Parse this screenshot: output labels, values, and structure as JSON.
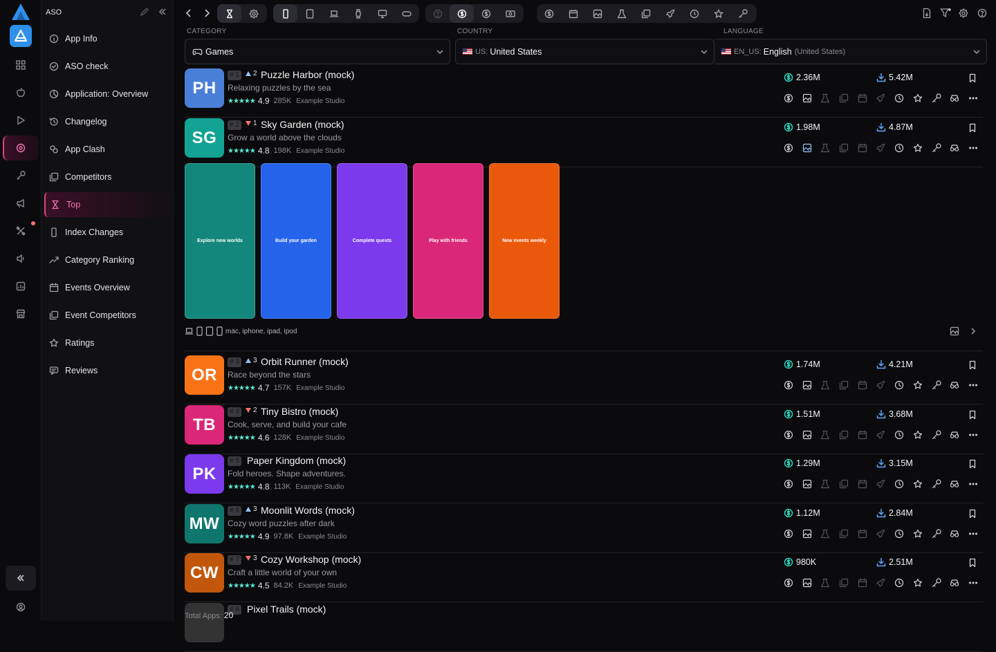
{
  "sidebar": {
    "title": "ASO",
    "items": [
      {
        "label": "App Info",
        "icon": "info-icon"
      },
      {
        "label": "ASO check",
        "icon": "check-circle-icon"
      },
      {
        "label": "Application: Overview",
        "icon": "chart-pie-icon"
      },
      {
        "label": "Changelog",
        "icon": "history-icon"
      },
      {
        "label": "App Clash",
        "icon": "clash-icon"
      },
      {
        "label": "Competitors",
        "icon": "copy-icon"
      },
      {
        "label": "Top",
        "icon": "hourglass-icon",
        "active": true
      },
      {
        "label": "Index Changes",
        "icon": "phone-icon"
      },
      {
        "label": "Category Ranking",
        "icon": "trending-icon"
      },
      {
        "label": "Events Overview",
        "icon": "calendar-icon"
      },
      {
        "label": "Event Competitors",
        "icon": "copy-icon"
      },
      {
        "label": "Ratings",
        "icon": "star-icon"
      },
      {
        "label": "Reviews",
        "icon": "review-icon"
      }
    ]
  },
  "filters": {
    "category_label": "CATEGORY",
    "category_value": "Games",
    "country_label": "COUNTRY",
    "country_code": "US:",
    "country_value": "United States",
    "language_label": "LANGUAGE",
    "language_code": "EN_US:",
    "language_value": "English",
    "language_region": "(United States)"
  },
  "apps": [
    {
      "initials": "PH",
      "color": "#4a7fd8",
      "rank": "# 1",
      "trend": "up",
      "delta": "2",
      "name": "Puzzle Harbor (mock)",
      "subtitle": "Relaxing puzzles by the sea",
      "stars": "★★★★★",
      "rating": "4.9",
      "count": "285K",
      "studio": "Example Studio",
      "revenue": "2.36M",
      "downloads": "5.42M"
    },
    {
      "initials": "SG",
      "color": "#13a394",
      "rank": "# 2",
      "trend": "down",
      "delta": "1",
      "name": "Sky Garden (mock)",
      "subtitle": "Grow a world above the clouds",
      "stars": "★★★★★",
      "rating": "4.8",
      "count": "198K",
      "studio": "Example Studio",
      "revenue": "1.98M",
      "downloads": "4.87M"
    },
    {
      "initials": "OR",
      "color": "#f97316",
      "rank": "# 3",
      "trend": "up",
      "delta": "3",
      "name": "Orbit Runner (mock)",
      "subtitle": "Race beyond the stars",
      "stars": "★★★★★",
      "rating": "4.7",
      "count": "157K",
      "studio": "Example Studio",
      "revenue": "1.74M",
      "downloads": "4.21M"
    },
    {
      "initials": "TB",
      "color": "#db2777",
      "rank": "# 4",
      "trend": "down",
      "delta": "2",
      "name": "Tiny Bistro (mock)",
      "subtitle": "Cook, serve, and build your cafe",
      "stars": "★★★★★",
      "rating": "4.6",
      "count": "128K",
      "studio": "Example Studio",
      "revenue": "1.51M",
      "downloads": "3.68M"
    },
    {
      "initials": "PK",
      "color": "#7c3aed",
      "rank": "# 5",
      "trend": "none",
      "delta": "",
      "name": "Paper Kingdom (mock)",
      "subtitle": "Fold heroes. Shape adventures.",
      "stars": "★★★★★",
      "rating": "4.8",
      "count": "113K",
      "studio": "Example Studio",
      "revenue": "1.29M",
      "downloads": "3.15M"
    },
    {
      "initials": "MW",
      "color": "#0f766e",
      "rank": "# 6",
      "trend": "up",
      "delta": "3",
      "name": "Moonlit Words (mock)",
      "subtitle": "Cozy word puzzles after dark",
      "stars": "★★★★★",
      "rating": "4.9",
      "count": "97.8K",
      "studio": "Example Studio",
      "revenue": "1.12M",
      "downloads": "2.84M"
    },
    {
      "initials": "CW",
      "color": "#c2570c",
      "rank": "# 7",
      "trend": "down",
      "delta": "3",
      "name": "Cozy Workshop (mock)",
      "subtitle": "Craft a little world of your own",
      "stars": "★★★★★",
      "rating": "4.5",
      "count": "84.2K",
      "studio": "Example Studio",
      "revenue": "980K",
      "downloads": "2.51M"
    },
    {
      "initials": "",
      "color": "#333",
      "rank": "# 8",
      "trend": "none",
      "delta": "",
      "name": "Pixel Trails (mock)",
      "subtitle": "",
      "stars": "",
      "rating": "",
      "count": "",
      "studio": "",
      "revenue": "",
      "downloads": ""
    }
  ],
  "screenshots": [
    {
      "caption": "Explore new worlds",
      "color": "#14877c"
    },
    {
      "caption": "Build your garden",
      "color": "#2563eb"
    },
    {
      "caption": "Complete quests",
      "color": "#7c3aed"
    },
    {
      "caption": "Play with friends",
      "color": "#db2777"
    },
    {
      "caption": "New events weekly",
      "color": "#ea580c"
    }
  ],
  "devices_text": "mac, iphone, ipad, ipod",
  "footer": {
    "label": "Total Apps:",
    "value": "20"
  },
  "colors": {
    "accent": "#e0457b",
    "revenue": "#2dd4bf",
    "downloads": "#60a5fa",
    "brand": "#2f8fe9"
  }
}
